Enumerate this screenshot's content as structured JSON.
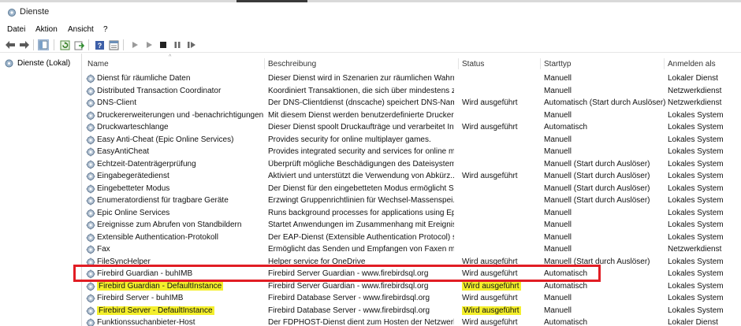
{
  "window": {
    "title": "Dienste",
    "title_icon": "gear-icon"
  },
  "menu": {
    "items": [
      "Datei",
      "Aktion",
      "Ansicht",
      "?"
    ]
  },
  "toolbar": {
    "buttons": [
      "back-arrow-icon",
      "forward-arrow-icon",
      "console-tree-icon",
      "refresh-icon",
      "export-icon",
      "help-icon",
      "properties-icon",
      "play-icon",
      "play-alt-icon",
      "stop-icon",
      "pause-icon",
      "restart-icon"
    ]
  },
  "tree": {
    "root_label": "Dienste (Lokal)"
  },
  "table": {
    "columns": {
      "name": "Name",
      "description": "Beschreibung",
      "status": "Status",
      "starttype": "Starttyp",
      "logon": "Anmelden als"
    },
    "rows": [
      {
        "name": "Dienst für räumliche Daten",
        "description": "Dieser Dienst wird in Szenarien zur räumlichen Wahrn...",
        "status": "",
        "starttype": "Manuell",
        "logon": "Lokaler Dienst",
        "highlight": false
      },
      {
        "name": "Distributed Transaction Coordinator",
        "description": "Koordiniert Transaktionen, die sich über mindestens z...",
        "status": "",
        "starttype": "Manuell",
        "logon": "Netzwerkdienst",
        "highlight": false
      },
      {
        "name": "DNS-Client",
        "description": "Der DNS-Clientdienst (dnscache) speichert DNS-Name...",
        "status": "Wird ausgeführt",
        "starttype": "Automatisch (Start durch Auslöser)",
        "logon": "Netzwerkdienst",
        "highlight": false
      },
      {
        "name": "Druckererweiterungen und -benachrichtigungen",
        "description": "Mit diesem Dienst werden benutzerdefinierte Drucker...",
        "status": "",
        "starttype": "Manuell",
        "logon": "Lokales System",
        "highlight": false
      },
      {
        "name": "Druckwarteschlange",
        "description": "Dieser Dienst spoolt Druckaufträge und verarbeitet Int...",
        "status": "Wird ausgeführt",
        "starttype": "Automatisch",
        "logon": "Lokales System",
        "highlight": false
      },
      {
        "name": "Easy Anti-Cheat (Epic Online Services)",
        "description": "Provides security for online multiplayer games.",
        "status": "",
        "starttype": "Manuell",
        "logon": "Lokales System",
        "highlight": false
      },
      {
        "name": "EasyAntiCheat",
        "description": "Provides integrated security and services for online m...",
        "status": "",
        "starttype": "Manuell",
        "logon": "Lokales System",
        "highlight": false
      },
      {
        "name": "Echtzeit-Datenträgerprüfung",
        "description": "Überprüft mögliche Beschädigungen des Dateisystems...",
        "status": "",
        "starttype": "Manuell (Start durch Auslöser)",
        "logon": "Lokales System",
        "highlight": false
      },
      {
        "name": "Eingabegerätedienst",
        "description": "Aktiviert und unterstützt die Verwendung von Abkürz...",
        "status": "Wird ausgeführt",
        "starttype": "Manuell (Start durch Auslöser)",
        "logon": "Lokales System",
        "highlight": false
      },
      {
        "name": "Eingebetteter Modus",
        "description": "Der Dienst für den eingebetteten Modus ermöglicht S...",
        "status": "",
        "starttype": "Manuell (Start durch Auslöser)",
        "logon": "Lokales System",
        "highlight": false
      },
      {
        "name": "Enumeratordienst für tragbare Geräte",
        "description": "Erzwingt Gruppenrichtlinien für Wechsel-Massenspei...",
        "status": "",
        "starttype": "Manuell (Start durch Auslöser)",
        "logon": "Lokales System",
        "highlight": false
      },
      {
        "name": "Epic Online Services",
        "description": "Runs background processes for applications using Epi...",
        "status": "",
        "starttype": "Manuell",
        "logon": "Lokales System",
        "highlight": false
      },
      {
        "name": "Ereignisse zum Abrufen von Standbildern",
        "description": "Startet Anwendungen im Zusammenhang mit Ereignis...",
        "status": "",
        "starttype": "Manuell",
        "logon": "Lokales System",
        "highlight": false
      },
      {
        "name": "Extensible Authentication-Protokoll",
        "description": "Der EAP-Dienst (Extensible Authentication Protocol) st...",
        "status": "",
        "starttype": "Manuell",
        "logon": "Lokales System",
        "highlight": false
      },
      {
        "name": "Fax",
        "description": "Ermöglicht das Senden und Empfangen von Faxen mit...",
        "status": "",
        "starttype": "Manuell",
        "logon": "Netzwerkdienst",
        "highlight": false
      },
      {
        "name": "FileSyncHelper",
        "description": "Helper service for OneDrive",
        "status": "Wird ausgeführt",
        "starttype": "Manuell (Start durch Auslöser)",
        "logon": "Lokales System",
        "highlight": false
      },
      {
        "name": "Firebird Guardian - buhIMB",
        "description": "Firebird Server Guardian - www.firebirdsql.org",
        "status": "Wird ausgeführt",
        "starttype": "Automatisch",
        "logon": "Lokales System",
        "highlight": false
      },
      {
        "name": "Firebird Guardian - DefaultInstance",
        "description": "Firebird Server Guardian - www.firebirdsql.org",
        "status": "Wird ausgeführt",
        "starttype": "Automatisch",
        "logon": "Lokales System",
        "highlight": true
      },
      {
        "name": "Firebird Server - buhIMB",
        "description": "Firebird Database Server - www.firebirdsql.org",
        "status": "Wird ausgeführt",
        "starttype": "Manuell",
        "logon": "Lokales System",
        "highlight": false
      },
      {
        "name": "Firebird Server - DefaultInstance",
        "description": "Firebird Database Server - www.firebirdsql.org",
        "status": "Wird ausgeführt",
        "starttype": "Manuell",
        "logon": "Lokales System",
        "highlight": true
      },
      {
        "name": "Funktionssuchanbieter-Host",
        "description": "Der FDPHOST-Dienst dient zum Hosten der Netzwerke...",
        "status": "Wird ausgeführt",
        "starttype": "Automatisch",
        "logon": "Lokaler Dienst",
        "highlight": false
      }
    ]
  },
  "annotation": {
    "box_color": "#e11d24",
    "highlight_color": "#f4ef2c"
  }
}
